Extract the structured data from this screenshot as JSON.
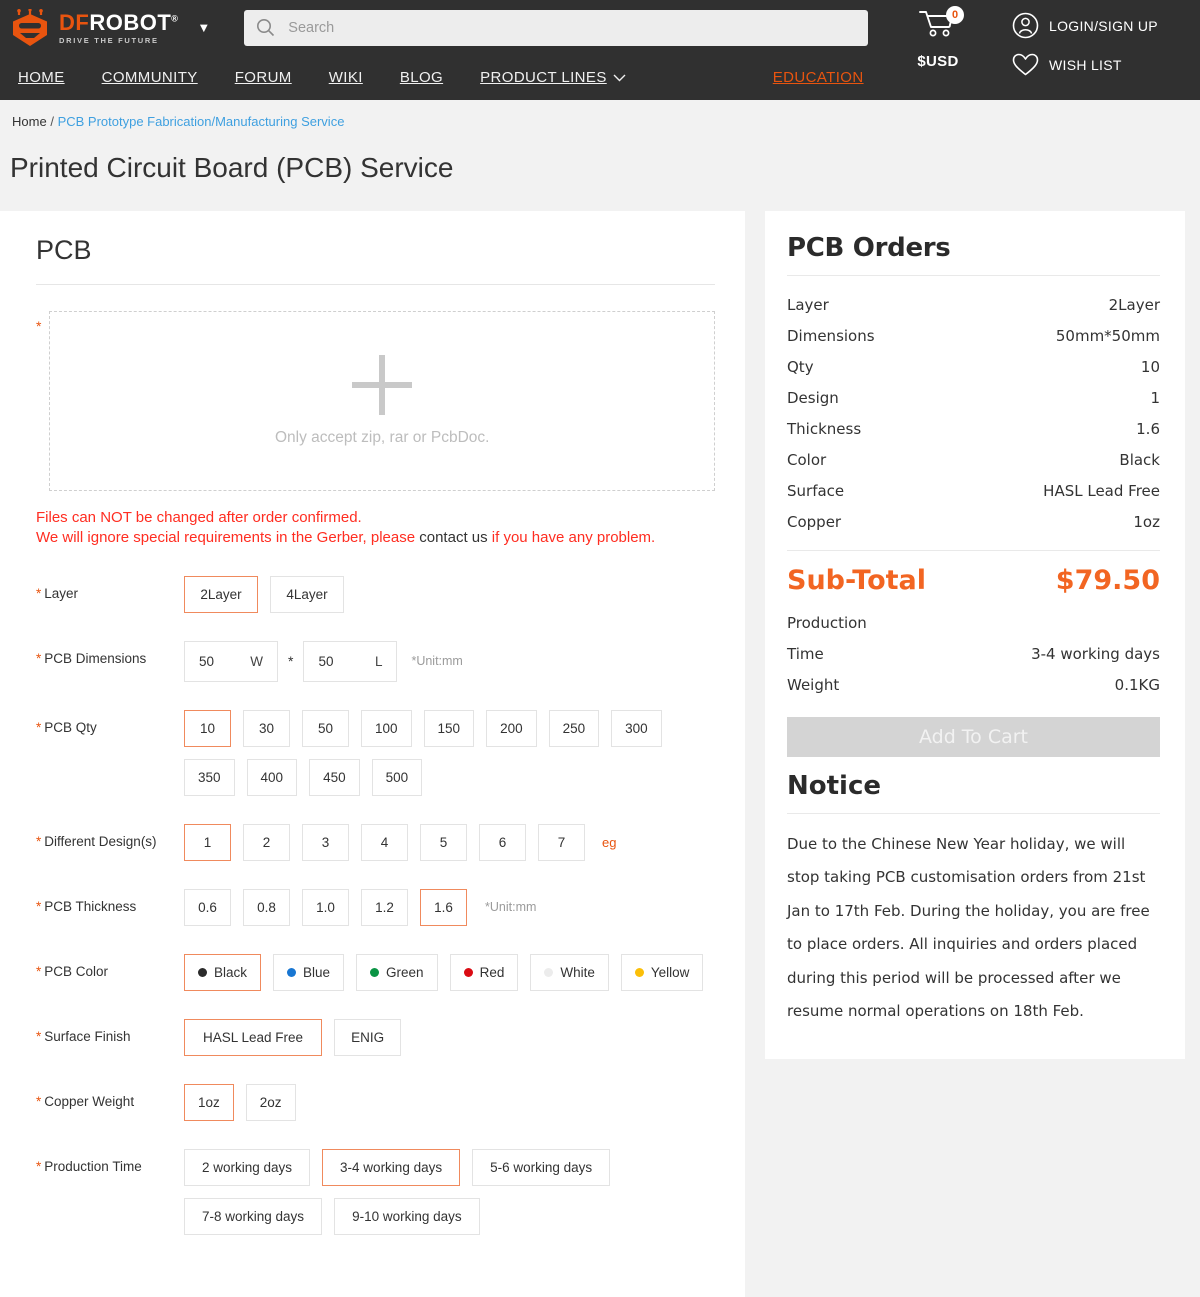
{
  "header": {
    "logo": {
      "df": "DF",
      "robot": "ROBOT",
      "reg": "®",
      "tagline": "DRIVE THE FUTURE",
      "caret_icon": "chevron-down-icon"
    },
    "search": {
      "placeholder": "Search",
      "value": "",
      "icon": "search-icon"
    },
    "cart": {
      "count": "0",
      "icon": "cart-icon"
    },
    "currency": "$USD",
    "account": {
      "label": "LOGIN/SIGN UP",
      "icon": "user-icon"
    },
    "wishlist": {
      "label": "WISH LIST",
      "icon": "heart-icon"
    },
    "nav": [
      {
        "label": "HOME",
        "accent": false,
        "caret": false
      },
      {
        "label": "COMMUNITY",
        "accent": false,
        "caret": false
      },
      {
        "label": "FORUM",
        "accent": false,
        "caret": false
      },
      {
        "label": "WIKI",
        "accent": false,
        "caret": false
      },
      {
        "label": "BLOG",
        "accent": false,
        "caret": false
      },
      {
        "label": "PRODUCT LINES",
        "accent": false,
        "caret": true
      },
      {
        "label": "EDUCATION",
        "accent": true,
        "caret": false
      }
    ]
  },
  "breadcrumb": {
    "home": "Home",
    "sep": "/",
    "current": "PCB Prototype Fabrication/Manufacturing Service"
  },
  "page_title": "Printed Circuit Board (PCB) Service",
  "left": {
    "section_title": "PCB",
    "upload": {
      "required": "*",
      "plus_icon": "plus-icon",
      "hint": "Only accept zip, rar or PcbDoc."
    },
    "warning": {
      "line1": "Files can NOT be changed after order confirmed.",
      "line2_a": "We will ignore special requirements in the Gerber, please ",
      "line2_link": "contact us",
      "line2_b": " if you have any problem."
    },
    "fields": {
      "layer": {
        "label": "Layer",
        "options": [
          "2Layer",
          "4Layer"
        ],
        "selected": "2Layer"
      },
      "dimensions": {
        "label": "PCB Dimensions",
        "width_value": "50",
        "width_unit": "W",
        "separator": "*",
        "length_value": "50",
        "length_unit": "L",
        "note": "*Unit:mm"
      },
      "qty": {
        "label": "PCB Qty",
        "options": [
          "10",
          "30",
          "50",
          "100",
          "150",
          "200",
          "250",
          "300",
          "350",
          "400",
          "450",
          "500"
        ],
        "selected": "10"
      },
      "designs": {
        "label": "Different Design(s)",
        "options": [
          "1",
          "2",
          "3",
          "4",
          "5",
          "6",
          "7"
        ],
        "selected": "1",
        "eg_link": "eg"
      },
      "thickness": {
        "label": "PCB Thickness",
        "options": [
          "0.6",
          "0.8",
          "1.0",
          "1.2",
          "1.6"
        ],
        "selected": "1.6",
        "note": "*Unit:mm"
      },
      "color": {
        "label": "PCB Color",
        "options": [
          {
            "label": "Black",
            "swatch": "#2b2b2b"
          },
          {
            "label": "Blue",
            "swatch": "#1876d2"
          },
          {
            "label": "Green",
            "swatch": "#0a9444"
          },
          {
            "label": "Red",
            "swatch": "#da0b13"
          },
          {
            "label": "White",
            "swatch": "#ececec"
          },
          {
            "label": "Yellow",
            "swatch": "#fbbf08"
          }
        ],
        "selected": "Black"
      },
      "surface": {
        "label": "Surface Finish",
        "options": [
          "HASL Lead Free",
          "ENIG"
        ],
        "selected": "HASL Lead Free"
      },
      "copper": {
        "label": "Copper Weight",
        "options": [
          "1oz",
          "2oz"
        ],
        "selected": "1oz"
      },
      "production_time": {
        "label": "Production Time",
        "options": [
          "2 working days",
          "3-4 working days",
          "5-6 working days",
          "7-8 working days",
          "9-10 working days"
        ],
        "selected": "3-4 working days"
      }
    }
  },
  "right": {
    "orders_title": "PCB Orders",
    "summary": [
      {
        "key": "Layer",
        "value": "2Layer"
      },
      {
        "key": "Dimensions",
        "value": "50mm*50mm"
      },
      {
        "key": "Qty",
        "value": "10"
      },
      {
        "key": "Design",
        "value": "1"
      },
      {
        "key": "Thickness",
        "value": "1.6"
      },
      {
        "key": "Color",
        "value": "Black"
      },
      {
        "key": "Surface",
        "value": "HASL Lead Free"
      },
      {
        "key": "Copper",
        "value": "1oz"
      }
    ],
    "subtotal_label": "Sub-Total",
    "subtotal_value": "$79.50",
    "production_label": "Production",
    "time_label": "Time",
    "time_value": "3-4 working days",
    "weight_label": "Weight",
    "weight_value": "0.1KG",
    "add_to_cart": "Add To Cart",
    "notice_title": "Notice",
    "notice_body": "Due to the Chinese New Year holiday, we will stop taking PCB customisation orders from 21st Jan to 17th Feb. During the holiday, you are free to place orders. All inquiries and orders placed during this period will be processed after we resume normal operations on 18th Feb."
  },
  "colors": {
    "accent": "#e8540f",
    "select_border": "#f08a5d",
    "warn": "#ff2d21",
    "link": "#3fa0e0",
    "header_bg": "#303030"
  }
}
